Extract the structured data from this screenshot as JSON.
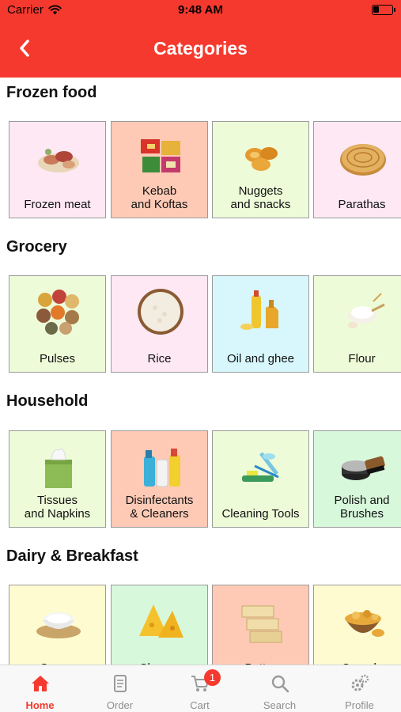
{
  "status_bar": {
    "carrier": "Carrier",
    "time": "9:48 AM",
    "battery_level": 0.3
  },
  "nav": {
    "title": "Categories",
    "back_icon": "chevron-left-icon"
  },
  "colors": {
    "brand": "#f6392e",
    "pink": "#fde8f4",
    "peach": "#fecab6",
    "lime": "#edfbd8",
    "cyan": "#d8f7fc",
    "mint": "#d8f8dc",
    "cream": "#fefbd0"
  },
  "sections": [
    {
      "title": "Frozen food",
      "items": [
        {
          "label": "Frozen meat",
          "bg": "#fde8f4",
          "icon": "frozen-meat-icon"
        },
        {
          "label": "Kebab\nand Koftas",
          "bg": "#fecab6",
          "icon": "kebab-icon"
        },
        {
          "label": "Nuggets\nand snacks",
          "bg": "#edfbd8",
          "icon": "nuggets-icon"
        },
        {
          "label": "Parathas",
          "bg": "#fde8f4",
          "icon": "paratha-icon"
        }
      ]
    },
    {
      "title": "Grocery",
      "items": [
        {
          "label": "Pulses",
          "bg": "#edfbd8",
          "icon": "pulses-icon"
        },
        {
          "label": "Rice",
          "bg": "#fde8f4",
          "icon": "rice-icon"
        },
        {
          "label": "Oil and ghee",
          "bg": "#d8f7fc",
          "icon": "oil-icon"
        },
        {
          "label": "Flour",
          "bg": "#edfbd8",
          "icon": "flour-icon"
        }
      ]
    },
    {
      "title": "Household",
      "items": [
        {
          "label": "Tissues\nand Napkins",
          "bg": "#edfbd8",
          "icon": "tissue-box-icon"
        },
        {
          "label": "Disinfectants\n& Cleaners",
          "bg": "#fecab6",
          "icon": "cleaner-bottles-icon"
        },
        {
          "label": "Cleaning Tools",
          "bg": "#edfbd8",
          "icon": "cleaning-tools-icon"
        },
        {
          "label": "Polish and\nBrushes",
          "bg": "#d8f8dc",
          "icon": "polish-brush-icon"
        }
      ]
    },
    {
      "title": "Dairy & Breakfast",
      "items": [
        {
          "label": "Cream",
          "bg": "#fefbd0",
          "icon": "cream-bowl-icon"
        },
        {
          "label": "Cheese",
          "bg": "#d8f8dc",
          "icon": "cheese-icon"
        },
        {
          "label": "Butter",
          "bg": "#fecab6",
          "icon": "butter-icon"
        },
        {
          "label": "Cereals",
          "bg": "#fefbd0",
          "icon": "cereal-bowl-icon"
        }
      ]
    }
  ],
  "tabs": [
    {
      "label": "Home",
      "icon": "home-icon",
      "active": true
    },
    {
      "label": "Order",
      "icon": "order-icon",
      "active": false
    },
    {
      "label": "Cart",
      "icon": "cart-icon",
      "active": false,
      "badge": "1"
    },
    {
      "label": "Search",
      "icon": "search-icon",
      "active": false
    },
    {
      "label": "Profile",
      "icon": "gear-icon",
      "active": false
    }
  ]
}
